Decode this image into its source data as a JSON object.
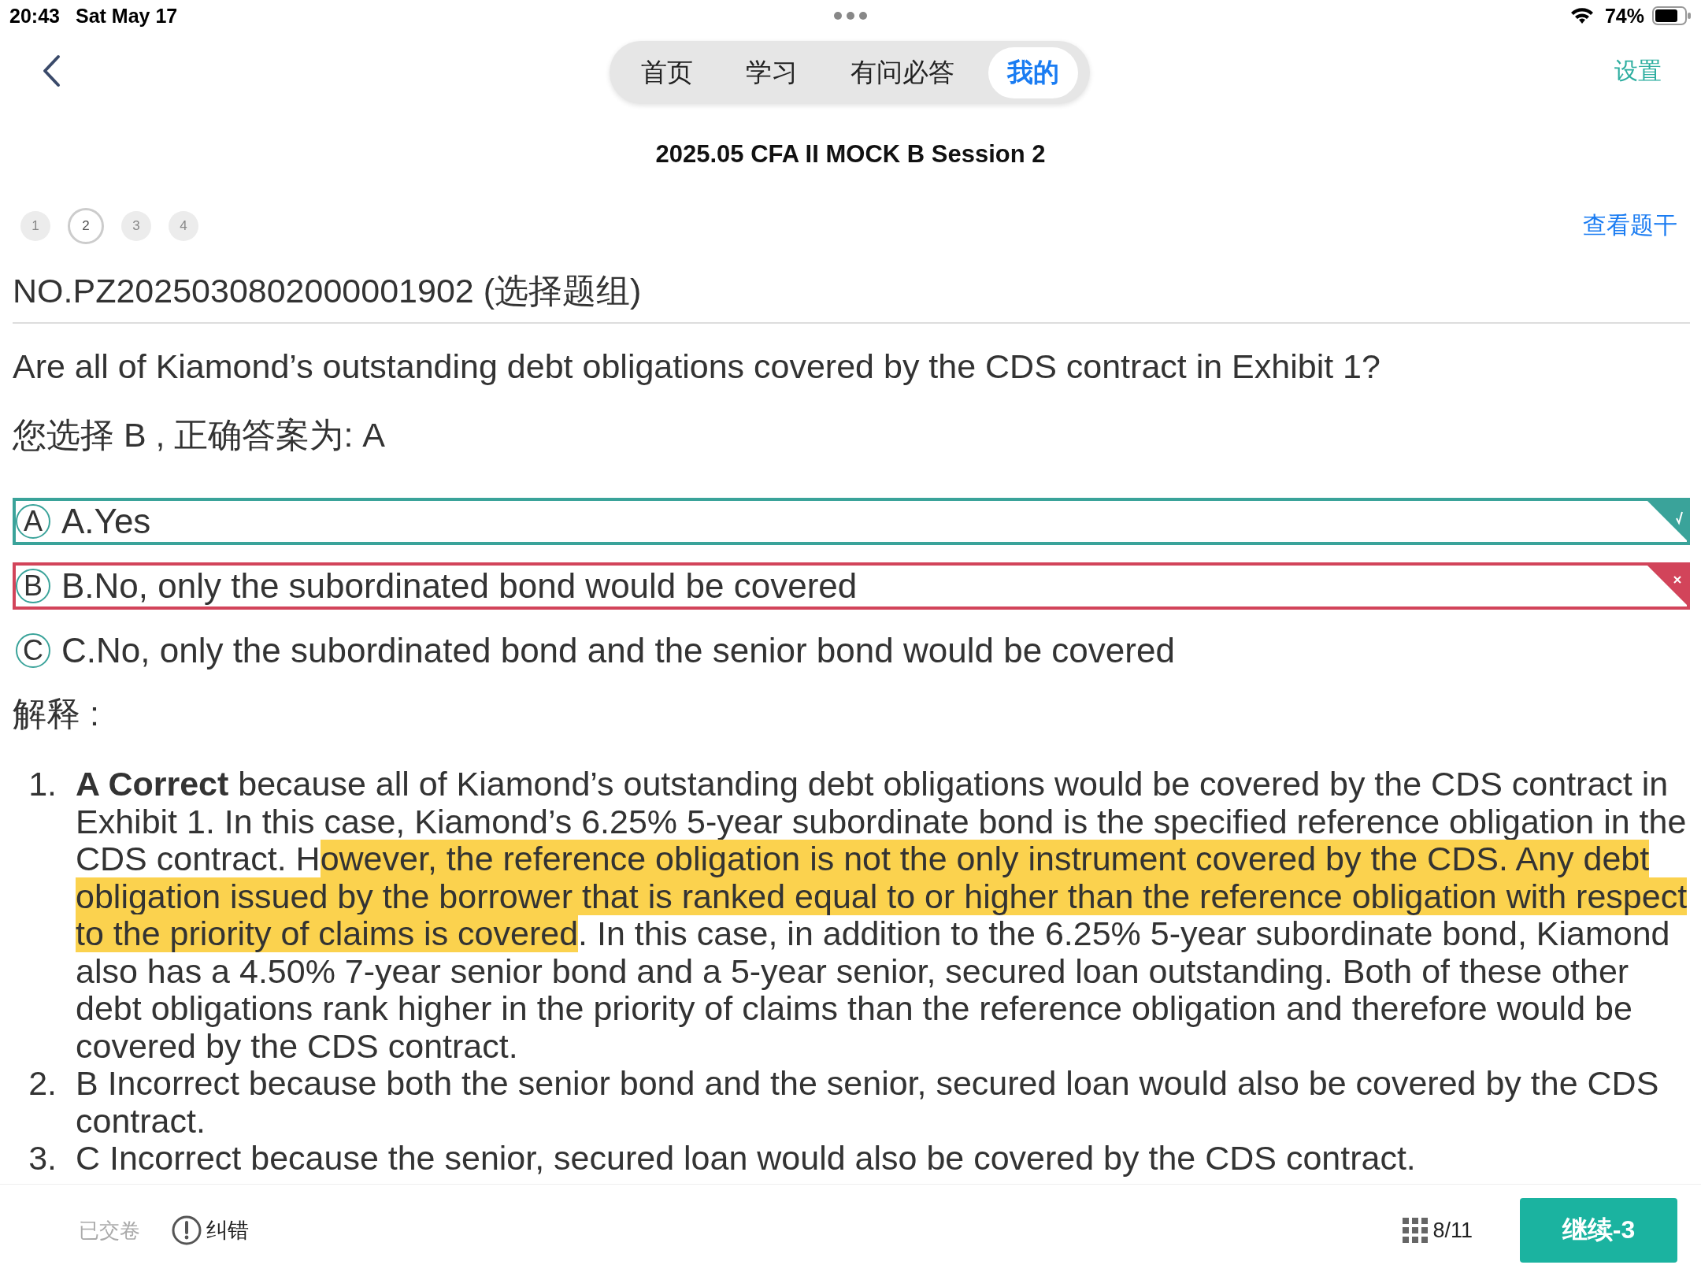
{
  "status_bar": {
    "time": "20:43",
    "date": "Sat May 17",
    "battery": "74%"
  },
  "nav": {
    "tabs": [
      {
        "label": "首页",
        "selected": false
      },
      {
        "label": "学习",
        "selected": false
      },
      {
        "label": "有问必答",
        "selected": false
      },
      {
        "label": "我的",
        "selected": true
      }
    ],
    "settings": "设置"
  },
  "title": "2025.05 CFA II MOCK B Session 2",
  "questions": [
    {
      "label": "1",
      "selected": false
    },
    {
      "label": "2",
      "selected": true
    },
    {
      "label": "3",
      "selected": false
    },
    {
      "label": "4",
      "selected": false
    }
  ],
  "view_stem": "查看题干",
  "question_no": "NO.PZ2025030802000001902 (选择题组)",
  "question": "Are all of Kiamond’s outstanding debt obligations covered by the CDS contract in Exhibit 1?",
  "your_answer": "您选择 B , 正确答案为: A",
  "options": [
    {
      "letter": "A",
      "text": "A.Yes",
      "selected": false,
      "correct": true
    },
    {
      "letter": "B",
      "text": "B.No, only the subordinated bond would be covered",
      "selected": true,
      "correct": false
    },
    {
      "letter": "C",
      "text": "C.No, only the subordinated bond and the senior bond would be covered",
      "selected": false,
      "correct": false
    }
  ],
  "explanation_label": "解释 :",
  "explanation": [
    {
      "number": "1.",
      "segments": [
        {
          "text": "**A Correct** because all of Kiamond’s outstanding debt obligations would be covered by the CDS contract in Exhibit 1. In this case, Kiamond’s 6.25% 5-year subordinate bond is the specified reference obligation in the CDS contract. H",
          "highlighted": false
        },
        {
          "text": "owever, the reference obligation is not the only instrument covered by the CDS. Any debt obligation issued by the borrower that is ranked equal to or higher than the reference obligation with respect to the priority of claims is covered",
          "highlighted": true
        },
        {
          "text": ". In this case, in addition to the 6.25% 5-year subordinate bond, Kiamond also has a 4.50% 7-year senior bond and a 5-year senior, secured loan outstanding. Both of these other debt obligations rank higher in the priority of claims than the reference obligation and therefore would be covered by the CDS contract.",
          "highlighted": false
        }
      ]
    },
    {
      "number": "2.",
      "segments": [
        {
          "text": "B Incorrect because both the senior bond and the senior, secured loan would also be covered by the CDS contract.",
          "highlighted": false
        }
      ]
    },
    {
      "number": "3.",
      "segments": [
        {
          "text": "C Incorrect because the senior, secured loan would also be covered by the CDS contract.",
          "highlighted": false
        }
      ]
    }
  ],
  "footer": {
    "submitted": "已交卷",
    "report": "纠错",
    "progress": "8/11",
    "continue": "继续-3"
  }
}
